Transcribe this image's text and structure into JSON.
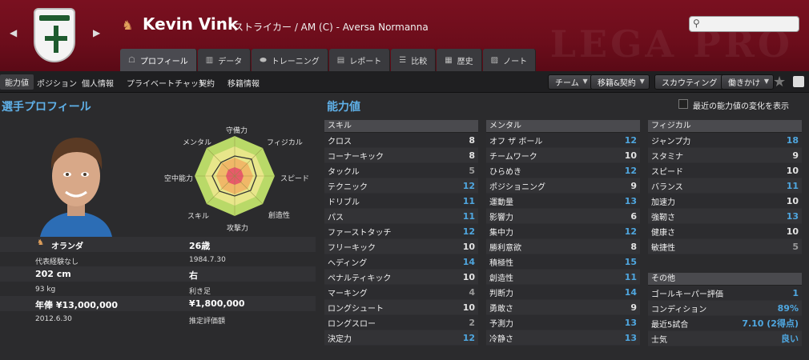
{
  "player": {
    "name": "Kevin Vink",
    "subtitle": "ストライカー / AM (C) - Aversa Normanna"
  },
  "tabs": [
    {
      "label": "プロフィール",
      "icon": "profile-icon"
    },
    {
      "label": "データ",
      "icon": "stats-icon"
    },
    {
      "label": "トレーニング",
      "icon": "training-icon"
    },
    {
      "label": "レポート",
      "icon": "report-icon"
    },
    {
      "label": "比較",
      "icon": "compare-icon"
    },
    {
      "label": "歴史",
      "icon": "history-icon"
    },
    {
      "label": "ノート",
      "icon": "notes-icon"
    }
  ],
  "subnav": [
    "能力値",
    "ポジション",
    "個人情報",
    "プライベートチャット",
    "契約",
    "移籍情報"
  ],
  "actions": [
    "チーム",
    "移籍&契約",
    "スカウティング",
    "働きかけ"
  ],
  "sections": {
    "profile_title": "選手プロフィール",
    "attributes_title": "能力値"
  },
  "show_changes_label": "最近の能力値の変化を表示",
  "radar": {
    "labels": {
      "top": "守備力",
      "top_right": "フィジカル",
      "right": "スピード",
      "bottom_right": "創造性",
      "bottom": "攻撃力",
      "bottom_left": "スキル",
      "left": "空中能力",
      "top_left": "メンタル"
    }
  },
  "info": {
    "nationality": "オランダ",
    "age": "26歳",
    "caps": "代表経験なし",
    "dob": "1984.7.30",
    "height": "202 cm",
    "foot": "右",
    "weight": "93 kg",
    "foot_label": "利き足",
    "salary": "年俸 ¥13,000,000",
    "value": "¥1,800,000",
    "contract_end": "2012.6.30",
    "value_label": "推定評価額"
  },
  "skills": {
    "header": "スキル",
    "rows": [
      {
        "name": "クロス",
        "value": "8",
        "tier": "mid"
      },
      {
        "name": "コーナーキック",
        "value": "8",
        "tier": "mid"
      },
      {
        "name": "タックル",
        "value": "5",
        "tier": "lo"
      },
      {
        "name": "テクニック",
        "value": "12",
        "tier": "hi"
      },
      {
        "name": "ドリブル",
        "value": "11",
        "tier": "hi"
      },
      {
        "name": "パス",
        "value": "11",
        "tier": "hi"
      },
      {
        "name": "ファーストタッチ",
        "value": "12",
        "tier": "hi"
      },
      {
        "name": "フリーキック",
        "value": "10",
        "tier": "mid"
      },
      {
        "name": "ヘディング",
        "value": "14",
        "tier": "hi"
      },
      {
        "name": "ペナルティキック",
        "value": "10",
        "tier": "mid"
      },
      {
        "name": "マーキング",
        "value": "4",
        "tier": "lo"
      },
      {
        "name": "ロングシュート",
        "value": "10",
        "tier": "mid"
      },
      {
        "name": "ロングスロー",
        "value": "2",
        "tier": "lo"
      },
      {
        "name": "決定力",
        "value": "12",
        "tier": "hi"
      }
    ]
  },
  "mental": {
    "header": "メンタル",
    "rows": [
      {
        "name": "オフ ザ ボール",
        "value": "12",
        "tier": "hi"
      },
      {
        "name": "チームワーク",
        "value": "10",
        "tier": "mid"
      },
      {
        "name": "ひらめき",
        "value": "12",
        "tier": "hi"
      },
      {
        "name": "ポジショニング",
        "value": "9",
        "tier": "mid"
      },
      {
        "name": "運動量",
        "value": "13",
        "tier": "hi"
      },
      {
        "name": "影響力",
        "value": "6",
        "tier": "mid"
      },
      {
        "name": "集中力",
        "value": "12",
        "tier": "hi"
      },
      {
        "name": "勝利意欲",
        "value": "8",
        "tier": "mid"
      },
      {
        "name": "積極性",
        "value": "15",
        "tier": "hi"
      },
      {
        "name": "創造性",
        "value": "11",
        "tier": "hi"
      },
      {
        "name": "判断力",
        "value": "14",
        "tier": "hi"
      },
      {
        "name": "勇敢さ",
        "value": "9",
        "tier": "mid"
      },
      {
        "name": "予測力",
        "value": "13",
        "tier": "hi"
      },
      {
        "name": "冷静さ",
        "value": "13",
        "tier": "hi"
      }
    ]
  },
  "physical": {
    "header": "フィジカル",
    "rows": [
      {
        "name": "ジャンプ力",
        "value": "18",
        "tier": "hi"
      },
      {
        "name": "スタミナ",
        "value": "9",
        "tier": "mid"
      },
      {
        "name": "スピード",
        "value": "10",
        "tier": "mid"
      },
      {
        "name": "バランス",
        "value": "11",
        "tier": "hi"
      },
      {
        "name": "加速力",
        "value": "10",
        "tier": "mid"
      },
      {
        "name": "強靭さ",
        "value": "13",
        "tier": "hi"
      },
      {
        "name": "健康さ",
        "value": "10",
        "tier": "mid"
      },
      {
        "name": "敏捷性",
        "value": "5",
        "tier": "lo"
      }
    ]
  },
  "other": {
    "header": "その他",
    "rows": [
      {
        "name": "ゴールキーパー評価",
        "value": "1",
        "tier": "hi"
      },
      {
        "name": "コンディション",
        "value": "89%",
        "tier": "hi"
      },
      {
        "name": "最近5試合",
        "value": "7.10 (2得点)",
        "tier": "hi"
      },
      {
        "name": "士気",
        "value": "良い",
        "tier": "hi"
      }
    ]
  }
}
